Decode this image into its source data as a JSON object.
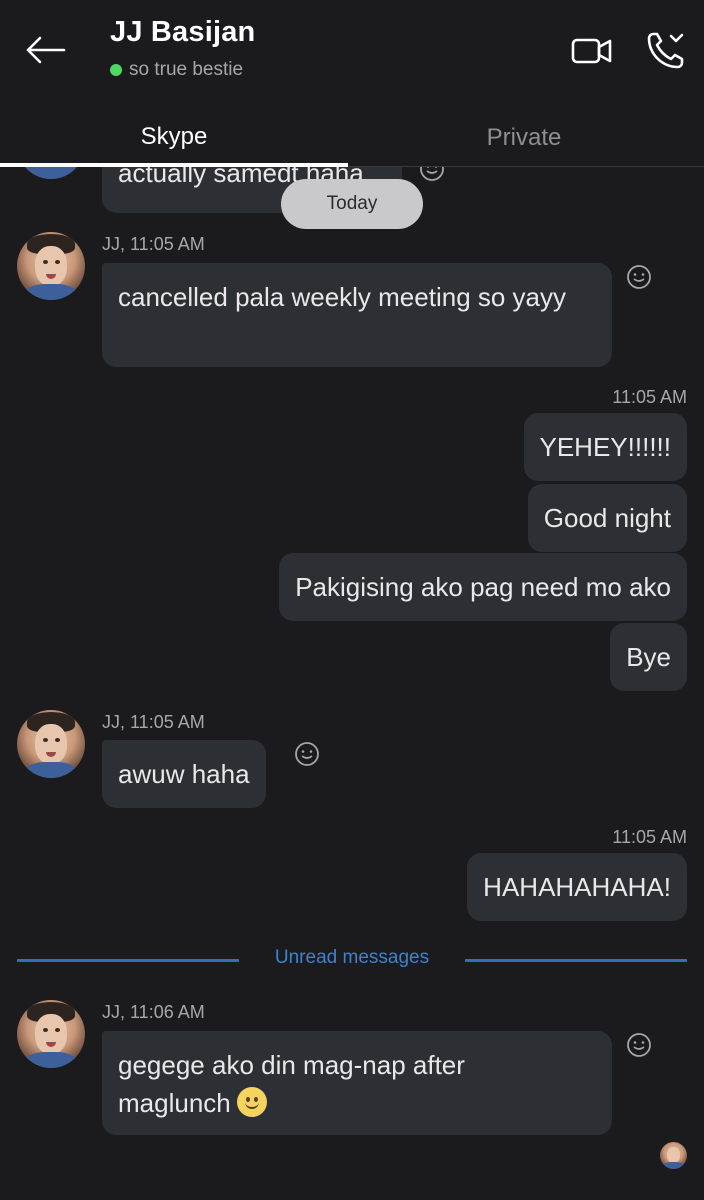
{
  "header": {
    "contact_name": "JJ Basijan",
    "status_text": "so true bestie",
    "status_color": "#4cd964",
    "back_icon": "arrow-left-icon",
    "video_icon": "video-camera-icon",
    "call_icon": "phone-chevron-icon"
  },
  "tabs": [
    {
      "label": "Skype",
      "active": true
    },
    {
      "label": "Private",
      "active": false
    }
  ],
  "date_pill": "Today",
  "messages": {
    "partial_prev": "actually samedt haha",
    "m1": {
      "meta": "JJ, 11:05 AM",
      "text": "cancelled pala weekly meeting so yayy"
    },
    "out_time_1": "11:05 AM",
    "out1": [
      "YEHEY!!!!!!",
      "Good night",
      "Pakigising ako pag need mo ako",
      "Bye"
    ],
    "m2": {
      "meta": "JJ, 11:05 AM",
      "text": "awuw haha"
    },
    "out_time_2": "11:05 AM",
    "out2": "HAHAHAHAHA!",
    "unread_label": "Unread messages",
    "m3": {
      "meta": "JJ, 11:06 AM",
      "text_line1": "gegege ako din mag-nap after",
      "text_line2": "maglunch"
    }
  },
  "colors": {
    "background": "#1b1b1d",
    "bubble": "#2c2f33",
    "unread_accent": "#3c82d6"
  }
}
